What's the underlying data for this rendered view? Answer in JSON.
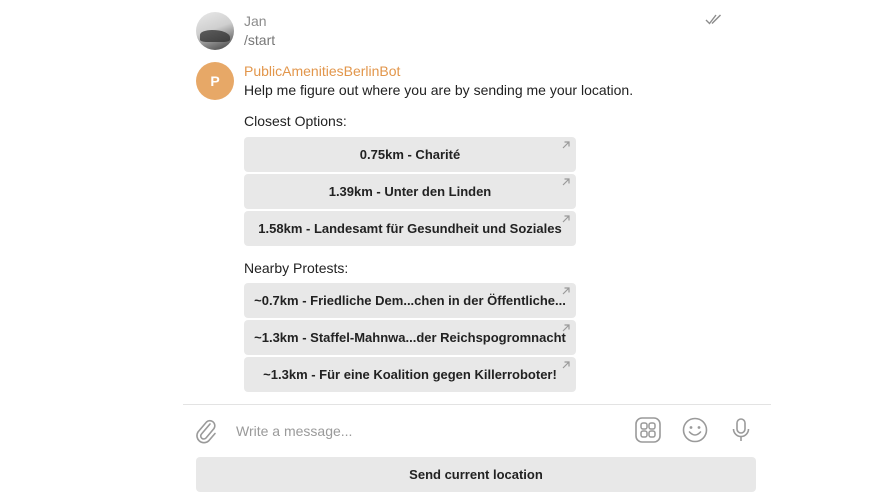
{
  "messages": [
    {
      "sender": "Jan",
      "text": "/start"
    },
    {
      "sender": "PublicAmenitiesBerlinBot",
      "avatar_initial": "P",
      "text": "Help me figure out where you are by sending me your location."
    }
  ],
  "closest": {
    "label": "Closest Options:",
    "buttons": [
      "0.75km - Charité",
      "1.39km - Unter den Linden",
      "1.58km - Landesamt für Gesundheit und Soziales"
    ]
  },
  "protests": {
    "label": "Nearby Protests:",
    "buttons": [
      "~0.7km - Friedliche Dem...chen in der Öffentliche...",
      "~1.3km - Staffel-Mahnwa...der Reichspogromnacht",
      "~1.3km - Für eine Koalition gegen Killerroboter!"
    ]
  },
  "composer": {
    "placeholder": "Write a message...",
    "send_location_label": "Send current location"
  },
  "colors": {
    "accent": "#e2964b",
    "button_bg": "#e8e8e8"
  }
}
